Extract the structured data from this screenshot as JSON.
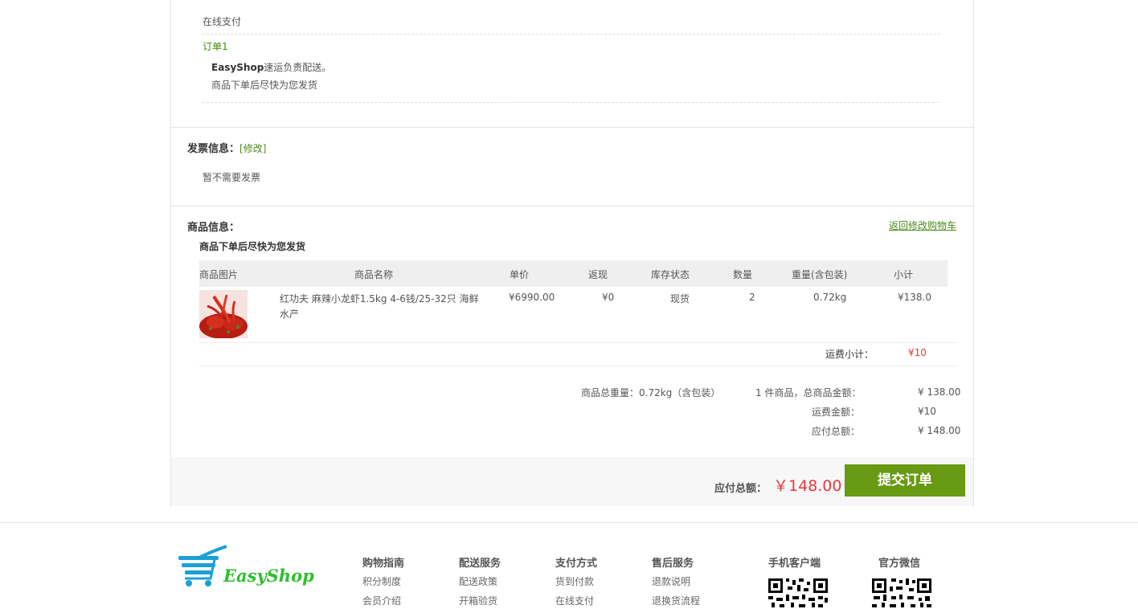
{
  "payment": {
    "method": "在线支付",
    "order_label": "订单1",
    "shipping_brand": "EasyShop",
    "shipping_text": "速运负责配送。",
    "shipping_note": "商品下单后尽快为您发货"
  },
  "invoice": {
    "title": "发票信息：",
    "modify": "[修改]",
    "value": "暂不需要发票"
  },
  "goods": {
    "title": "商品信息：",
    "back_link": "返回修改购物车",
    "subtitle": "商品下单后尽快为您发货",
    "columns": [
      "商品图片",
      "商品名称",
      "单价",
      "返现",
      "库存状态",
      "数量",
      "重量(含包装)",
      "小计"
    ],
    "item": {
      "name": "红功夫 麻辣小龙虾1.5kg 4-6钱/25-32只 海鲜水产",
      "price": "¥6990.00",
      "cashback": "¥0",
      "stock": "现货",
      "quantity": "2",
      "weight": "0.72kg",
      "subtotal": "¥138.0"
    },
    "shipping_subtotal_label": "运费小计：",
    "shipping_subtotal": "¥10"
  },
  "summary": {
    "total_weight": "商品总重量：0.72kg（含包装）",
    "items_total_label": "1 件商品，总商品金额：",
    "items_total": "¥ 138.00",
    "shipping_label": "运费金额：",
    "shipping": "¥10",
    "payable_label": "应付总额：",
    "payable": "¥ 148.00"
  },
  "bottom": {
    "payable_label": "应付总额：",
    "payable": "￥148.00",
    "submit": "提交订单"
  },
  "footer": {
    "logo_text": "EasyShop",
    "columns": [
      {
        "title": "购物指南",
        "links": [
          "积分制度",
          "会员介绍"
        ]
      },
      {
        "title": "配送服务",
        "links": [
          "配送政策",
          "开箱验货"
        ]
      },
      {
        "title": "支付方式",
        "links": [
          "货到付款",
          "在线支付"
        ]
      },
      {
        "title": "售后服务",
        "links": [
          "退款说明",
          "退换货流程"
        ]
      }
    ],
    "mobile_title": "手机客户端",
    "wechat_title": "官方微信"
  },
  "colors": {
    "accent_green": "#689a13",
    "link_green": "#4a8a1c",
    "price_red": "#e4393c",
    "logo_blue": "#1aa0d8",
    "logo_green": "#2fbf2f"
  }
}
